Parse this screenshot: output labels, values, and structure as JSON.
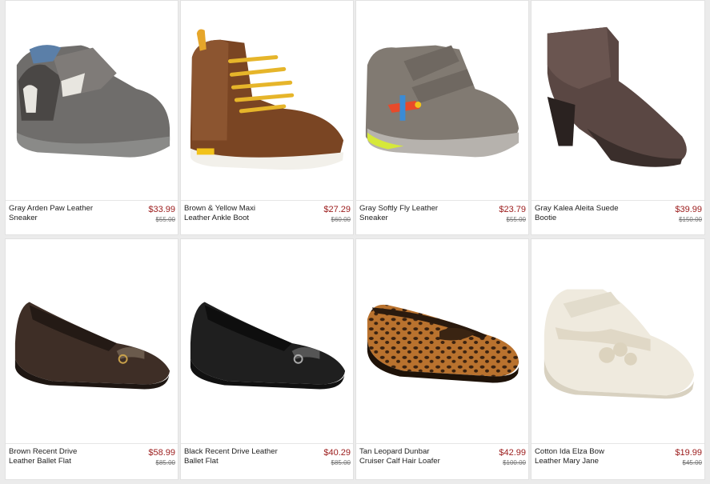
{
  "products": [
    {
      "name": "Gray Arden Paw Leather Sneaker",
      "price": "$33.99",
      "old_price": "$55.00",
      "image": "gray-sneaker-paw"
    },
    {
      "name": "Brown & Yellow Maxi Leather Ankle Boot",
      "price": "$27.29",
      "old_price": "$60.00",
      "image": "brown-yellow-boot"
    },
    {
      "name": "Gray Softly Fly Leather Sneaker",
      "price": "$23.79",
      "old_price": "$55.00",
      "image": "gray-airplane-sneaker"
    },
    {
      "name": "Gray Kalea Aleita Suede Bootie",
      "price": "$39.99",
      "old_price": "$150.00",
      "image": "suede-heeled-bootie"
    },
    {
      "name": "Brown Recent Drive Leather Ballet Flat",
      "price": "$58.99",
      "old_price": "$85.00",
      "image": "brown-ballet-flat"
    },
    {
      "name": "Black Recent Drive Leather Ballet Flat",
      "price": "$40.29",
      "old_price": "$85.00",
      "image": "black-ballet-flat"
    },
    {
      "name": "Tan Leopard Dunbar Cruiser Calf Hair Loafer",
      "price": "$42.99",
      "old_price": "$100.00",
      "image": "leopard-loafer"
    },
    {
      "name": "Cotton Ida Elza Bow Leather Mary Jane",
      "price": "$19.99",
      "old_price": "$45.00",
      "image": "cream-mary-jane"
    }
  ],
  "colors": {
    "price": "#9b1b1b",
    "background": "#ebebeb",
    "card": "#ffffff"
  }
}
